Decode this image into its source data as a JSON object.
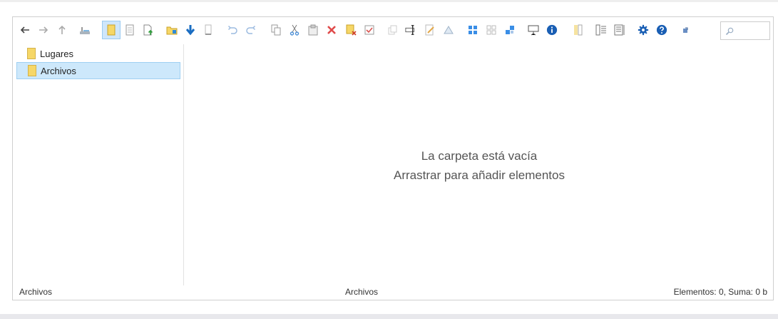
{
  "tree": {
    "items": [
      {
        "label": "Lugares",
        "selected": false
      },
      {
        "label": "Archivos",
        "selected": true
      }
    ]
  },
  "content": {
    "empty_line1": "La carpeta está vacía",
    "empty_line2": "Arrastrar para añadir elementos"
  },
  "statusbar": {
    "left": "Archivos",
    "center": "Archivos",
    "right": "Elementos: 0, Suma: 0 b"
  },
  "search": {
    "value": ""
  },
  "toolbar": {
    "icons": [
      "back-icon",
      "forward-icon",
      "up-icon",
      "home-icon",
      "folder-view-icon",
      "file-icon",
      "upload-icon",
      "new-folder-icon",
      "download-icon",
      "file-copy-icon",
      "undo-icon",
      "redo-icon",
      "copy-icon",
      "cut-icon",
      "paste-icon",
      "delete-icon",
      "delete-folder-icon",
      "select-icon",
      "duplicate-icon",
      "rename-icon",
      "edit-icon",
      "resize-icon",
      "view-icons-icon",
      "view-small-icon",
      "view-list-icon",
      "slideshow-icon",
      "info-icon",
      "columns-icon",
      "details-icon",
      "preview-icon",
      "settings-icon",
      "help-icon",
      "fullscreen-icon"
    ]
  },
  "colors": {
    "accent": "#1a6dc2",
    "selection": "#cde8fb",
    "folder": "#f6d767",
    "delete": "#e04a4a"
  }
}
